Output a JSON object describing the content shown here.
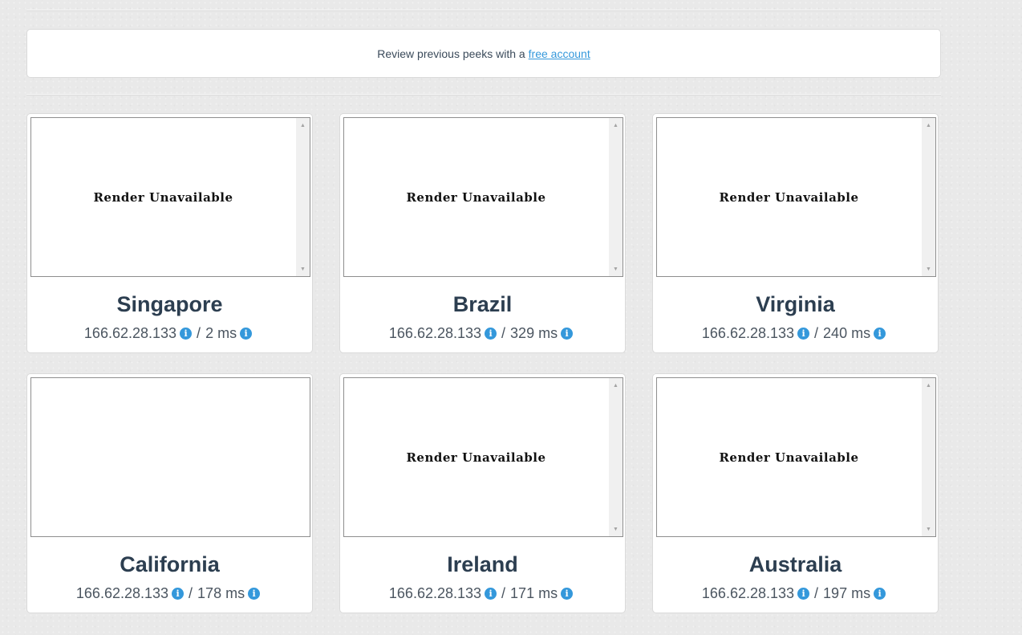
{
  "notice": {
    "text": "Review previous peeks with a",
    "link_label": "free account"
  },
  "render_message": "Render Unavailable",
  "scroll_up": "▲",
  "scroll_down": "▼",
  "info_glyph": "i",
  "separator": "/",
  "locations": [
    {
      "city": "Singapore",
      "ip": "166.62.28.133",
      "latency": "2 ms",
      "render_unavailable": true
    },
    {
      "city": "Brazil",
      "ip": "166.62.28.133",
      "latency": "329 ms",
      "render_unavailable": true
    },
    {
      "city": "Virginia",
      "ip": "166.62.28.133",
      "latency": "240 ms",
      "render_unavailable": true
    },
    {
      "city": "California",
      "ip": "166.62.28.133",
      "latency": "178 ms",
      "render_unavailable": false
    },
    {
      "city": "Ireland",
      "ip": "166.62.28.133",
      "latency": "171 ms",
      "render_unavailable": true
    },
    {
      "city": "Australia",
      "ip": "166.62.28.133",
      "latency": "197 ms",
      "render_unavailable": true
    }
  ],
  "colors": {
    "accent": "#3498db",
    "heading": "#2c3e50"
  }
}
